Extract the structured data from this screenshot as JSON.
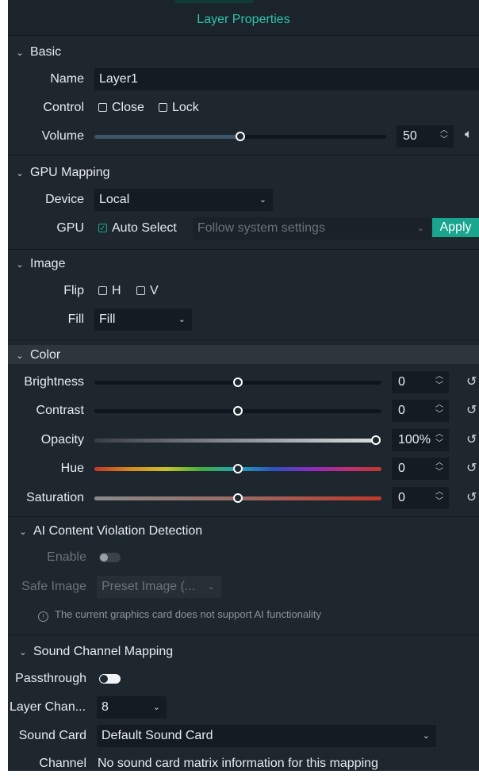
{
  "window": {
    "title": "Layer Properties"
  },
  "basic": {
    "header": "Basic",
    "name_label": "Name",
    "name_value": "Layer1",
    "control_label": "Control",
    "close_label": "Close",
    "lock_label": "Lock",
    "volume_label": "Volume",
    "volume_value": "50",
    "volume_level_pct": 50
  },
  "gpu": {
    "header": "GPU Mapping",
    "device_label": "Device",
    "device_value": "Local",
    "gpu_label": "GPU",
    "auto_select_label": "Auto Select",
    "auto_select_checked": true,
    "gpu_select_placeholder": "Follow system settings",
    "apply_label": "Apply"
  },
  "image": {
    "header": "Image",
    "flip_label": "Flip",
    "flip_h_label": "H",
    "flip_v_label": "V",
    "fill_label": "Fill",
    "fill_value": "Fill"
  },
  "color": {
    "header": "Color",
    "brightness": {
      "label": "Brightness",
      "value": "0",
      "level_pct": 50
    },
    "contrast": {
      "label": "Contrast",
      "value": "0",
      "level_pct": 50
    },
    "opacity": {
      "label": "Opacity",
      "value": "100%",
      "level_pct": 100
    },
    "hue": {
      "label": "Hue",
      "value": "0",
      "level_pct": 50
    },
    "saturation": {
      "label": "Saturation",
      "value": "0",
      "level_pct": 50
    }
  },
  "ai": {
    "header": "AI Content Violation Detection",
    "enable_label": "Enable",
    "safe_image_label": "Safe Image",
    "safe_image_value": "Preset Image (...",
    "info_text": "The current graphics card does not support AI functionality"
  },
  "sound": {
    "header": "Sound Channel Mapping",
    "passthrough_label": "Passthrough",
    "layer_channel_label": "Layer Chan...",
    "layer_channel_value": "8",
    "sound_card_label": "Sound Card",
    "sound_card_value": "Default Sound Card",
    "channel_label": "Channel",
    "channel_text": "No sound card matrix information for this mapping"
  },
  "colors": {
    "accent": "#1aa58f",
    "title": "#2ec4ad",
    "panel_bg": "#1e272e"
  },
  "icons": [
    "chevron-down-icon",
    "checkbox-icon",
    "spin-up-icon",
    "spin-down-icon",
    "speaker-icon",
    "reset-icon",
    "info-icon"
  ]
}
